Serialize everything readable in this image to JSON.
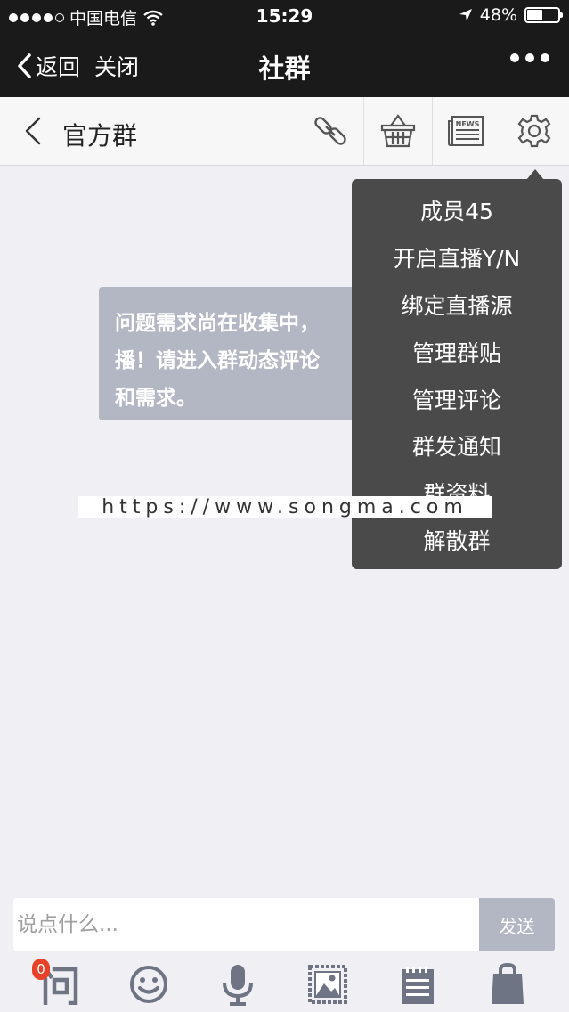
{
  "status_bar": {
    "carrier": "中国电信",
    "time": "15:29",
    "battery_text": "48%",
    "battery_level": 0.48
  },
  "nav": {
    "back_label": "返回",
    "close_label": "关闭",
    "title": "社群"
  },
  "group_header": {
    "title": "官方群",
    "tools": [
      "link-icon",
      "basket-icon",
      "news-icon",
      "settings-icon"
    ],
    "news_icon_text": "NEWS"
  },
  "message": {
    "lines": [
      "问题需求尚在收集中，",
      "播！请进入群动态评论",
      "和需求。"
    ]
  },
  "menu": {
    "items": [
      "成员45",
      "开启直播Y/N",
      "绑定直播源",
      "管理群贴",
      "管理评论",
      "群发通知",
      "群资料",
      "解散群"
    ]
  },
  "watermark": "https://www.songma.com",
  "input": {
    "placeholder": "说点什么...",
    "value": "",
    "send_label": "发送"
  },
  "bottom_bar": {
    "question_badge": "0",
    "items": [
      "question-icon",
      "emoji-icon",
      "microphone-icon",
      "image-icon",
      "notepad-icon",
      "bag-icon"
    ]
  },
  "colors": {
    "dark_bar": "#1a1a1a",
    "menu_bg": "#4a4a4a",
    "bubble_bg": "#b3b6c3",
    "icon_gray": "#6e7484",
    "badge_red": "#e8412a"
  }
}
